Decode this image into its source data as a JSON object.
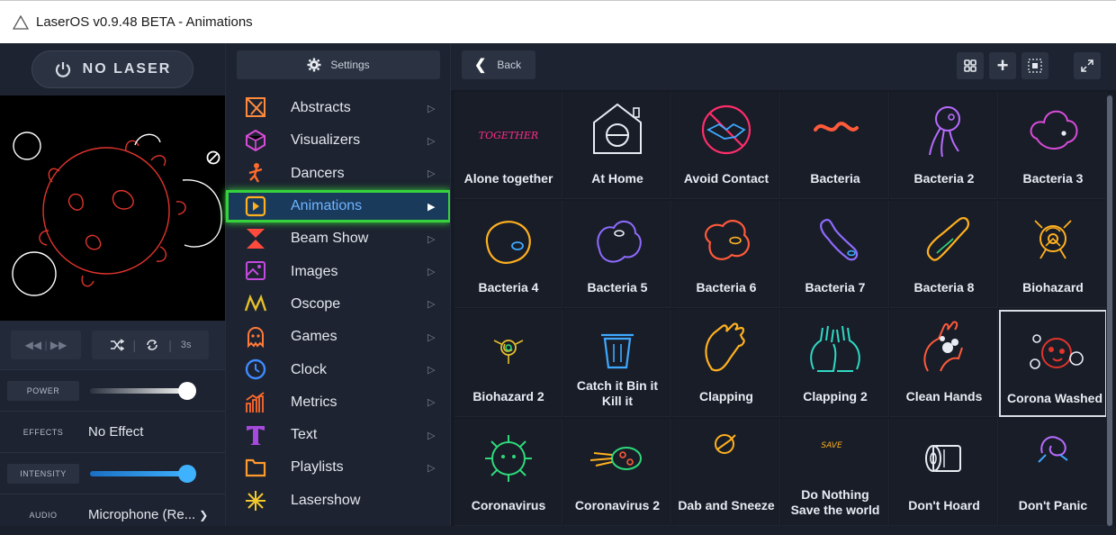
{
  "window": {
    "title": "LaserOS v0.9.48 BETA - Animations"
  },
  "left": {
    "laser_button": "NO LASER",
    "transport": {
      "speed": "3s"
    },
    "controls": {
      "power_label": "POWER",
      "power_level": 0.9,
      "effects_label": "EFFECTS",
      "effects_value": "No Effect",
      "intensity_label": "INTENSITY",
      "intensity_level": 0.9,
      "audio_label": "AUDIO",
      "audio_value": "Microphone (Re..."
    }
  },
  "middle": {
    "settings_label": "Settings",
    "menu": [
      {
        "label": "Abstracts",
        "icon": "abstracts-icon",
        "color": "#ff8a3d"
      },
      {
        "label": "Visualizers",
        "icon": "visualizers-icon",
        "color": "#d94cd8"
      },
      {
        "label": "Dancers",
        "icon": "dancers-icon",
        "color": "#ff6a2d"
      },
      {
        "label": "Animations",
        "icon": "animations-icon",
        "color": "#ffb01f"
      },
      {
        "label": "Beam Show",
        "icon": "beam-show-icon",
        "color": "#ff4a3d"
      },
      {
        "label": "Images",
        "icon": "images-icon",
        "color": "#c44adf"
      },
      {
        "label": "Oscope",
        "icon": "oscope-icon",
        "color": "#e6c02a"
      },
      {
        "label": "Games",
        "icon": "games-icon",
        "color": "#ff7a3a"
      },
      {
        "label": "Clock",
        "icon": "clock-icon",
        "color": "#3e8bff"
      },
      {
        "label": "Metrics",
        "icon": "metrics-icon",
        "color": "#ff6a2d"
      },
      {
        "label": "Text",
        "icon": "text-icon",
        "color": "#a64adf"
      },
      {
        "label": "Playlists",
        "icon": "playlists-icon",
        "color": "#ff9a2d"
      },
      {
        "label": "Lasershow",
        "icon": "lasershow-icon",
        "color": "#f2c82d"
      }
    ],
    "active_index": 3
  },
  "right": {
    "back_label": "Back",
    "tiles": [
      {
        "label": "Alone together",
        "icon": "together-icon"
      },
      {
        "label": "At Home",
        "icon": "home-icon"
      },
      {
        "label": "Avoid Contact",
        "icon": "no-handshake-icon"
      },
      {
        "label": "Bacteria",
        "icon": "bacteria-icon"
      },
      {
        "label": "Bacteria 2",
        "icon": "bacteria-icon"
      },
      {
        "label": "Bacteria 3",
        "icon": "bacteria-icon"
      },
      {
        "label": "Bacteria 4",
        "icon": "bacteria-icon"
      },
      {
        "label": "Bacteria 5",
        "icon": "bacteria-icon"
      },
      {
        "label": "Bacteria 6",
        "icon": "bacteria-icon"
      },
      {
        "label": "Bacteria 7",
        "icon": "bacteria-icon"
      },
      {
        "label": "Bacteria 8",
        "icon": "bacteria-icon"
      },
      {
        "label": "Biohazard",
        "icon": "biohazard-icon"
      },
      {
        "label": "Biohazard 2",
        "icon": "biohazard-icon"
      },
      {
        "label": "Catch it Bin it Kill it",
        "icon": "bin-icon"
      },
      {
        "label": "Clapping",
        "icon": "clapping-icon"
      },
      {
        "label": "Clapping 2",
        "icon": "clapping-icon"
      },
      {
        "label": "Clean Hands",
        "icon": "wash-hands-icon"
      },
      {
        "label": "Corona Washed",
        "icon": "corona-icon"
      },
      {
        "label": "Coronavirus",
        "icon": "virus-icon"
      },
      {
        "label": "Coronavirus 2",
        "icon": "virus-icon"
      },
      {
        "label": "Dab and Sneeze",
        "icon": "sneeze-icon"
      },
      {
        "label": "Do Nothing Save the world",
        "icon": "sofa-icon"
      },
      {
        "label": "Don't Hoard",
        "icon": "toilet-paper-icon"
      },
      {
        "label": "Don't Panic",
        "icon": "panic-icon"
      }
    ],
    "selected_index": 17,
    "tile_texts": {
      "together": "TOGETHER",
      "save": "SAVE"
    }
  }
}
